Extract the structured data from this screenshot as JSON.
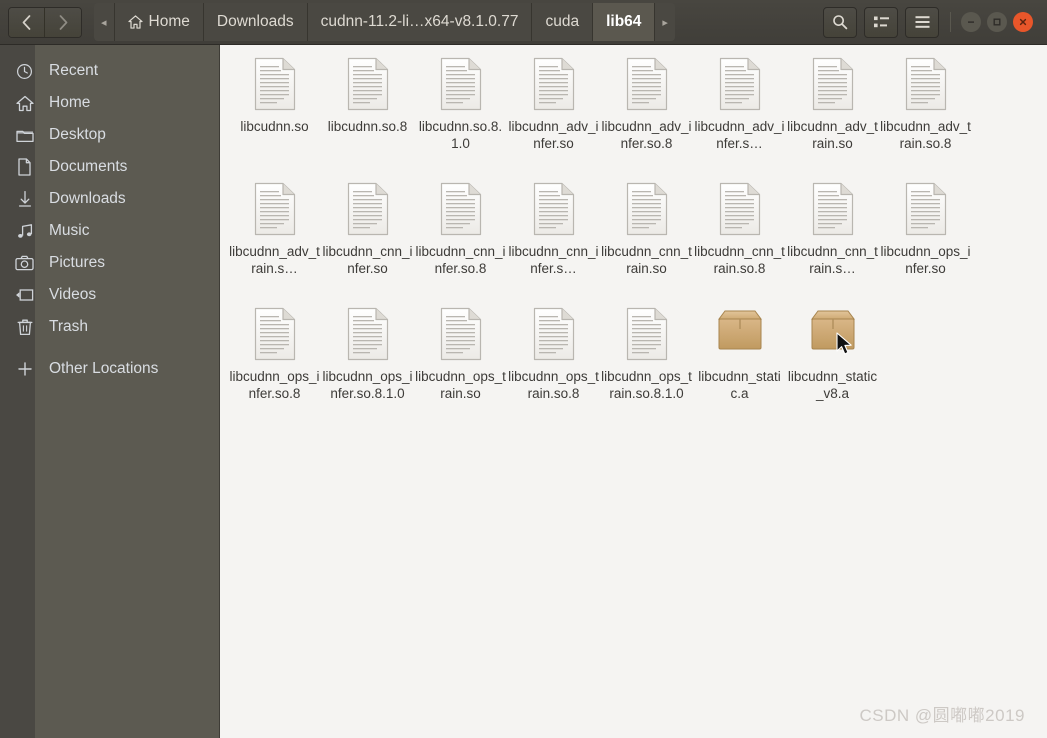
{
  "window": {
    "title": "lib64",
    "min_label": "Minimize",
    "max_label": "Maximize",
    "close_label": "Close"
  },
  "header": {
    "back_label": "‹",
    "forward_label": "›",
    "breadcrumb_prev_label": "◂",
    "breadcrumb_next_label": "▸",
    "breadcrumbs": [
      {
        "label": "Home",
        "icon": "home-icon",
        "active": false
      },
      {
        "label": "Downloads",
        "icon": "",
        "active": false
      },
      {
        "label": "cudnn-11.2-li…x64-v8.1.0.77",
        "icon": "",
        "active": false
      },
      {
        "label": "cuda",
        "icon": "",
        "active": false
      },
      {
        "label": "lib64",
        "icon": "",
        "active": true
      }
    ],
    "actions": [
      {
        "name": "search-icon",
        "label": "Search"
      },
      {
        "name": "view-options-icon",
        "label": "View options"
      },
      {
        "name": "menu-icon",
        "label": "Menu"
      }
    ]
  },
  "sidebar": {
    "items": [
      {
        "label": "Recent",
        "icon": "clock-icon"
      },
      {
        "label": "Home",
        "icon": "home-icon"
      },
      {
        "label": "Desktop",
        "icon": "folder-icon"
      },
      {
        "label": "Documents",
        "icon": "document-icon"
      },
      {
        "label": "Downloads",
        "icon": "download-icon"
      },
      {
        "label": "Music",
        "icon": "music-note-icon"
      },
      {
        "label": "Pictures",
        "icon": "camera-icon"
      },
      {
        "label": "Videos",
        "icon": "film-icon"
      },
      {
        "label": "Trash",
        "icon": "trash-icon"
      }
    ],
    "other": {
      "label": "Other Locations",
      "icon": "plus-icon"
    }
  },
  "files": [
    {
      "name": "libcudnn.so",
      "type": "document"
    },
    {
      "name": "libcudnn.so.8",
      "type": "document"
    },
    {
      "name": "libcudnn.so.8.1.0",
      "type": "document"
    },
    {
      "name": "libcudnn_adv_infer.so",
      "type": "document"
    },
    {
      "name": "libcudnn_adv_infer.so.8",
      "type": "document"
    },
    {
      "name": "libcudnn_adv_infer.s…",
      "type": "document"
    },
    {
      "name": "libcudnn_adv_train.so",
      "type": "document"
    },
    {
      "name": "libcudnn_adv_train.so.8",
      "type": "document"
    },
    {
      "name": "libcudnn_adv_train.s…",
      "type": "document"
    },
    {
      "name": "libcudnn_cnn_infer.so",
      "type": "document"
    },
    {
      "name": "libcudnn_cnn_infer.so.8",
      "type": "document"
    },
    {
      "name": "libcudnn_cnn_infer.s…",
      "type": "document"
    },
    {
      "name": "libcudnn_cnn_train.so",
      "type": "document"
    },
    {
      "name": "libcudnn_cnn_train.so.8",
      "type": "document"
    },
    {
      "name": "libcudnn_cnn_train.s…",
      "type": "document"
    },
    {
      "name": "libcudnn_ops_infer.so",
      "type": "document"
    },
    {
      "name": "libcudnn_ops_infer.so.8",
      "type": "document"
    },
    {
      "name": "libcudnn_ops_infer.so.8.1.0",
      "type": "document"
    },
    {
      "name": "libcudnn_ops_train.so",
      "type": "document"
    },
    {
      "name": "libcudnn_ops_train.so.8",
      "type": "document"
    },
    {
      "name": "libcudnn_ops_train.so.8.1.0",
      "type": "document"
    },
    {
      "name": "libcudnn_static.a",
      "type": "archive"
    },
    {
      "name": "libcudnn_static_v8.a",
      "type": "archive",
      "cursor": true
    }
  ],
  "watermark": {
    "text": "CSDN @圆嘟嘟2019"
  },
  "colors": {
    "headerbar": "#443f39",
    "sidebar": "#5c5a51",
    "rail": "#4a4843",
    "content": "#f5f4f2",
    "close_button": "#e8562a",
    "archive_icon": "#c9a26b"
  }
}
